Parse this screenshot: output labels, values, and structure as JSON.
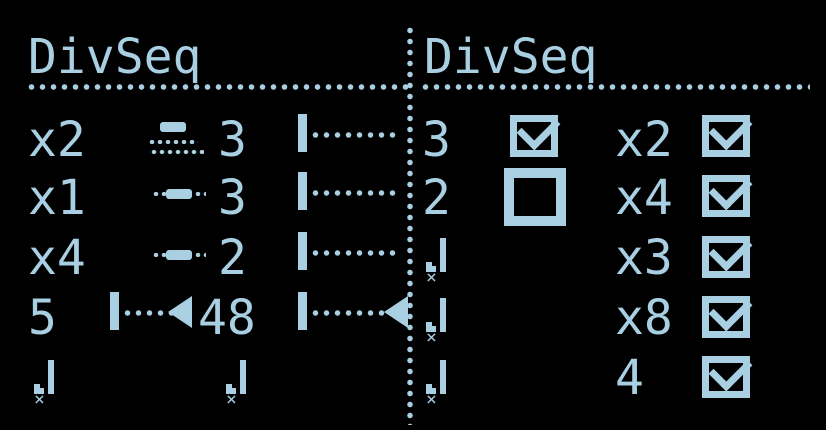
{
  "left": {
    "title": "DivSeq",
    "rows": [
      {
        "mult": "x2",
        "ratio_icon": "wide-pill-icon",
        "ratio_value": "3",
        "slider_icon": "slider-bar-icon"
      },
      {
        "mult": "x1",
        "ratio_icon": "pill-icon",
        "ratio_value": "3",
        "slider_icon": "slider-bar-icon"
      },
      {
        "mult": "x4",
        "ratio_icon": "pill-icon",
        "ratio_value": "2",
        "slider_icon": "slider-bar-icon"
      },
      {
        "mult": "5",
        "range_value": "48",
        "slider_icon": "slider-bar-with-arrow-icon"
      },
      {
        "note_left": "note-icon",
        "note_right": "note-icon"
      }
    ]
  },
  "right": {
    "title": "DivSeq",
    "rows": [
      {
        "left": "3",
        "left_checked": true,
        "right": "x2",
        "right_checked": true
      },
      {
        "left": "2",
        "left_checked": false,
        "right": "x4",
        "right_checked": true
      },
      {
        "left_icon": "note-icon",
        "right": "x3",
        "right_checked": true
      },
      {
        "left_icon": "note-icon",
        "right": "x8",
        "right_checked": true
      },
      {
        "left_icon": "note-icon",
        "right": "4",
        "right_checked": true
      }
    ]
  },
  "colors": {
    "foreground": "#a9cfe3",
    "background": "#000000"
  }
}
